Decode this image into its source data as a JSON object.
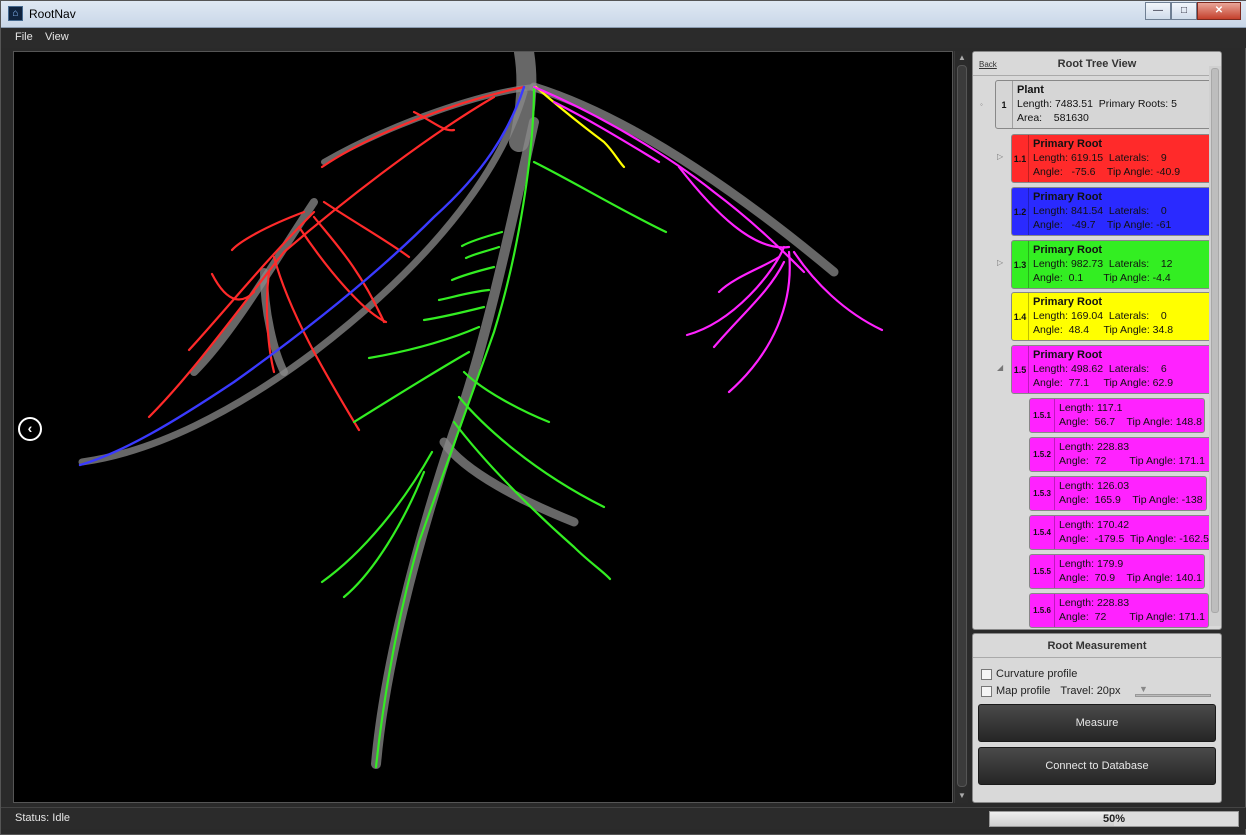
{
  "window": {
    "title": "RootNav",
    "controls": [
      "minimize",
      "maximize",
      "close"
    ]
  },
  "menu": {
    "items": [
      "File",
      "View"
    ]
  },
  "viewer": {
    "back_icon": "chevron-left-circle-icon"
  },
  "tree_panel": {
    "back_label": "Back",
    "title": "Root Tree View",
    "plant": {
      "num": "1",
      "name": "Plant",
      "line2": "Length: 7483.51  Primary Roots: 5",
      "line3": "Area:    581630"
    },
    "primaries": [
      {
        "num": "1.1",
        "name": "Primary Root",
        "line2": "Length: 619.15  Laterals:    9",
        "line3": "Angle:   -75.6    Tip Angle: -40.9",
        "color": "#ff2a2a",
        "expander": "▷"
      },
      {
        "num": "1.2",
        "name": "Primary Root",
        "line2": "Length: 841.54  Laterals:    0",
        "line3": "Angle:   -49.7    Tip Angle: -61",
        "color": "#2a2aff",
        "expander": ""
      },
      {
        "num": "1.3",
        "name": "Primary Root",
        "line2": "Length: 982.73  Laterals:    12",
        "line3": "Angle:  0.1       Tip Angle: -4.4",
        "color": "#33ee22",
        "expander": "▷"
      },
      {
        "num": "1.4",
        "name": "Primary Root",
        "line2": "Length: 169.04  Laterals:    0",
        "line3": "Angle:  48.4     Tip Angle: 34.8",
        "color": "#ffff00",
        "expander": ""
      },
      {
        "num": "1.5",
        "name": "Primary Root",
        "line2": "Length: 498.62  Laterals:    6",
        "line3": "Angle:  77.1     Tip Angle: 62.9",
        "color": "#ff22ff",
        "expander": "◢"
      }
    ],
    "laterals": [
      {
        "num": "1.5.1",
        "line1": "Length: 117.1",
        "line2": "Angle:  56.7    Tip Angle: 148.8"
      },
      {
        "num": "1.5.2",
        "line1": "Length: 228.83",
        "line2": "Angle:  72        Tip Angle: 171.1"
      },
      {
        "num": "1.5.3",
        "line1": "Length: 126.03",
        "line2": "Angle:  165.9    Tip Angle: -138"
      },
      {
        "num": "1.5.4",
        "line1": "Length: 170.42",
        "line2": "Angle:  -179.5  Tip Angle: -162.5"
      },
      {
        "num": "1.5.5",
        "line1": "Length: 179.9",
        "line2": "Angle:  70.9    Tip Angle: 140.1"
      },
      {
        "num": "1.5.6",
        "line1": "Length: 228.83",
        "line2": "Angle:  72        Tip Angle: 171.1"
      }
    ]
  },
  "measurement": {
    "title": "Root Measurement",
    "curvature_label": "Curvature profile",
    "map_label": "Map profile",
    "travel_label": "Travel:  20px",
    "measure_button": "Measure",
    "database_button": "Connect to Database"
  },
  "status": {
    "text": "Status: Idle",
    "progress_label": "50%",
    "progress": 0.5
  },
  "colors": {
    "red_root": "#ff2a2a",
    "blue_root": "#2a2aff",
    "green_root": "#33ee22",
    "yellow_root": "#ffff00",
    "magenta_root": "#ff22ff"
  }
}
